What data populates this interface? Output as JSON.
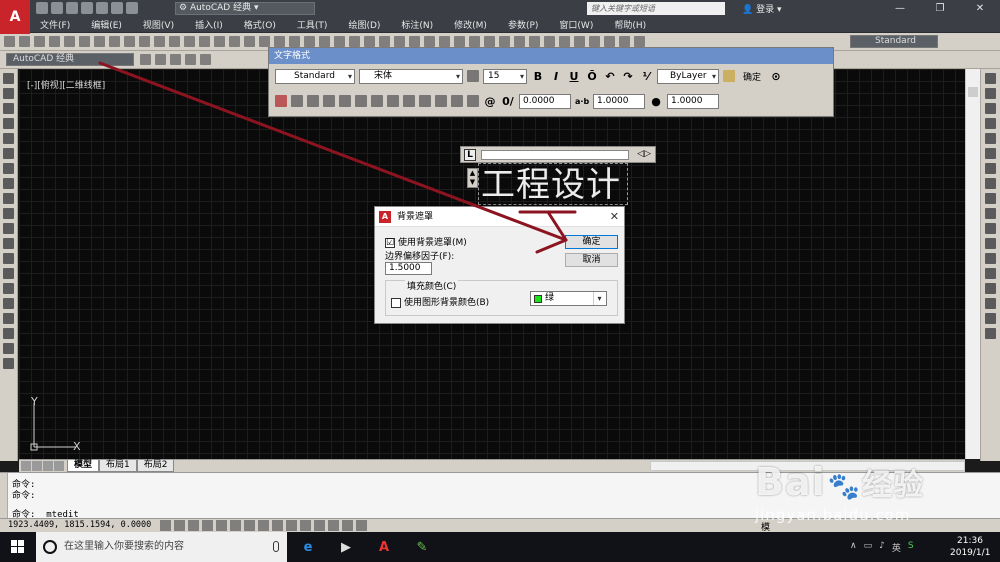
{
  "titlebar": {
    "workspace": "AutoCAD 经典",
    "search_placeholder": "键入关键字或短语",
    "login": "登录"
  },
  "menubar": {
    "items": [
      "文件(F)",
      "编辑(E)",
      "视图(V)",
      "插入(I)",
      "格式(O)",
      "工具(T)",
      "绘图(D)",
      "标注(N)",
      "修改(M)",
      "参数(P)",
      "窗口(W)",
      "帮助(H)"
    ]
  },
  "toolbar": {
    "workspace_combo": "AutoCAD 经典",
    "text_style": "Standard"
  },
  "viewport": {
    "label": "[-][俯视][二维线框]"
  },
  "text_format": {
    "title": "文字格式",
    "style": "Standard",
    "font": "宋体",
    "height": "15",
    "bold": "B",
    "italic": "I",
    "underline": "U",
    "overline": "Ō",
    "color": "ByLayer",
    "ok_label": "确定",
    "oblique": "0.0000",
    "tracking": "1.0000",
    "width_factor": "1.0000"
  },
  "mtext": {
    "content": "工程设计"
  },
  "dialog": {
    "title": "背景遮罩",
    "use_mask_label": "使用背景遮罩(M)",
    "use_mask_checked": "☑",
    "offset_label": "边界偏移因子(F):",
    "offset_value": "1.5000",
    "fill_color_label": "填充颜色(C)",
    "use_bg_label": "使用图形背景颜色(B)",
    "color_value": "绿",
    "ok_label": "确定",
    "cancel_label": "取消",
    "swatch_color": "#19e319"
  },
  "tabs": {
    "items": [
      "模型",
      "布局1",
      "布局2"
    ]
  },
  "command": {
    "line1": "命令:",
    "line2": "命令:",
    "line3": "命令: _mtedit"
  },
  "status": {
    "coords": "1923.4409, 1815.1594, 0.0000",
    "model": "模"
  },
  "taskbar": {
    "search_placeholder": "在这里输入你要搜索的内容",
    "time": "21:36",
    "date": "2019/1/1"
  },
  "watermark": {
    "brand": "Bai",
    "brand_cn": "经验",
    "url": "jingyan.baidu.com"
  },
  "colors": {
    "accent_arrow": "#8b1420",
    "titlebar": "#3b3f45",
    "canvas": "#0a0a0a"
  }
}
